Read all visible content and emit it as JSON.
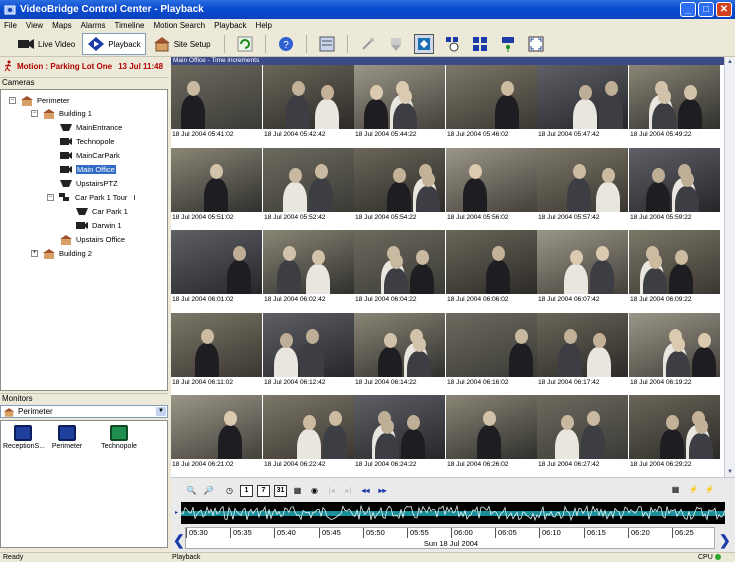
{
  "window": {
    "title": "VideoBridge Control Center - Playback"
  },
  "menu": [
    "File",
    "View",
    "Maps",
    "Alarms",
    "Timeline",
    "Motion Search",
    "Playback",
    "Help"
  ],
  "toolbar": {
    "live_video": "Live Video",
    "playback": "Playback",
    "site_setup": "Site Setup"
  },
  "alert": {
    "text": "Motion : Parking Lot One",
    "time": "13 Jul 11:48"
  },
  "cameras": {
    "header": "Cameras",
    "tree": [
      {
        "label": "Perimeter",
        "type": "site",
        "expander": "−"
      },
      {
        "label": "Building 1",
        "type": "site",
        "expander": "−"
      },
      {
        "label": "MainEntrance",
        "type": "dome"
      },
      {
        "label": "Technopole",
        "type": "box"
      },
      {
        "label": "MainCarPark",
        "type": "box"
      },
      {
        "label": "Main Office",
        "type": "box",
        "selected": true
      },
      {
        "label": "UpstairsPTZ",
        "type": "dome"
      },
      {
        "label": "Car Park 1 Tour",
        "type": "tour",
        "expander": "−",
        "suffix": "I"
      },
      {
        "label": "Car Park 1",
        "type": "dome"
      },
      {
        "label": "Darwin 1",
        "type": "box"
      },
      {
        "label": "Upstairs Office",
        "type": "site"
      },
      {
        "label": "Building 2",
        "type": "site",
        "expander": "+"
      }
    ]
  },
  "monitors": {
    "header": "Monitors",
    "selected": "Perimeter",
    "items": [
      {
        "label": "ReceptionS...",
        "color": "#1f3f9e"
      },
      {
        "label": "Perimeter",
        "color": "#1f3f9e"
      },
      {
        "label": "Technopole",
        "color": "#1f8f4f"
      }
    ]
  },
  "grid": {
    "title": "Main Office - Time increments",
    "timestamps": [
      "18 Jul 2004 05:41:02",
      "18 Jul 2004 05:42:42",
      "18 Jul 2004 05:44:22",
      "18 Jul 2004 05:46:02",
      "18 Jul 2004 05:47:42",
      "18 Jul 2004 05:49:22",
      "18 Jul 2004 05:51:02",
      "18 Jul 2004 05:52:42",
      "18 Jul 2004 05:54:22",
      "18 Jul 2004 05:56:02",
      "18 Jul 2004 05:57:42",
      "18 Jul 2004 05:59:22",
      "18 Jul 2004 06:01:02",
      "18 Jul 2004 06:02:42",
      "18 Jul 2004 06:04:22",
      "18 Jul 2004 06:06:02",
      "18 Jul 2004 06:07:42",
      "18 Jul 2004 06:09:22",
      "18 Jul 2004 06:11:02",
      "18 Jul 2004 06:12:42",
      "18 Jul 2004 06:14:22",
      "18 Jul 2004 06:16:02",
      "18 Jul 2004 06:17:42",
      "18 Jul 2004 06:19:22",
      "18 Jul 2004 06:21:02",
      "18 Jul 2004 06:22:42",
      "18 Jul 2004 06:24:22",
      "18 Jul 2004 06:26:02",
      "18 Jul 2004 06:27:42",
      "18 Jul 2004 06:29:22"
    ]
  },
  "timeline": {
    "ticks": [
      "05:30",
      "05:35",
      "05:40",
      "05:45",
      "05:50",
      "05:55",
      "06:00",
      "06:05",
      "06:10",
      "06:15",
      "06:20",
      "06:25"
    ],
    "date": "Sun 18 Jul 2004",
    "buttons": [
      "1",
      "7",
      "31"
    ]
  },
  "status": {
    "left": "Ready",
    "mode": "Playback",
    "cpu": "CPU"
  }
}
